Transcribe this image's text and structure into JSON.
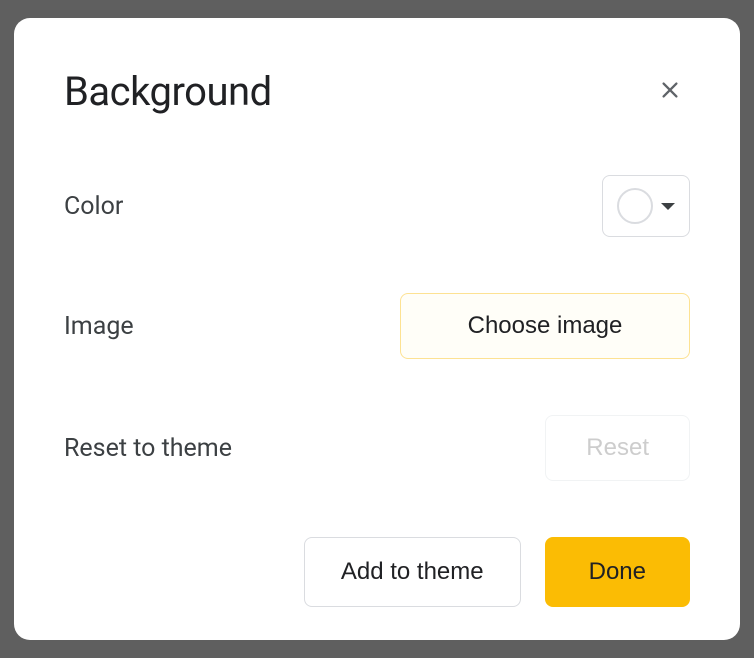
{
  "dialog": {
    "title": "Background",
    "options": {
      "color": {
        "label": "Color",
        "selected_color": "#ffffff"
      },
      "image": {
        "label": "Image",
        "button_label": "Choose image"
      },
      "reset": {
        "label": "Reset to theme",
        "button_label": "Reset"
      }
    },
    "footer": {
      "add_to_theme_label": "Add to theme",
      "done_label": "Done"
    }
  }
}
